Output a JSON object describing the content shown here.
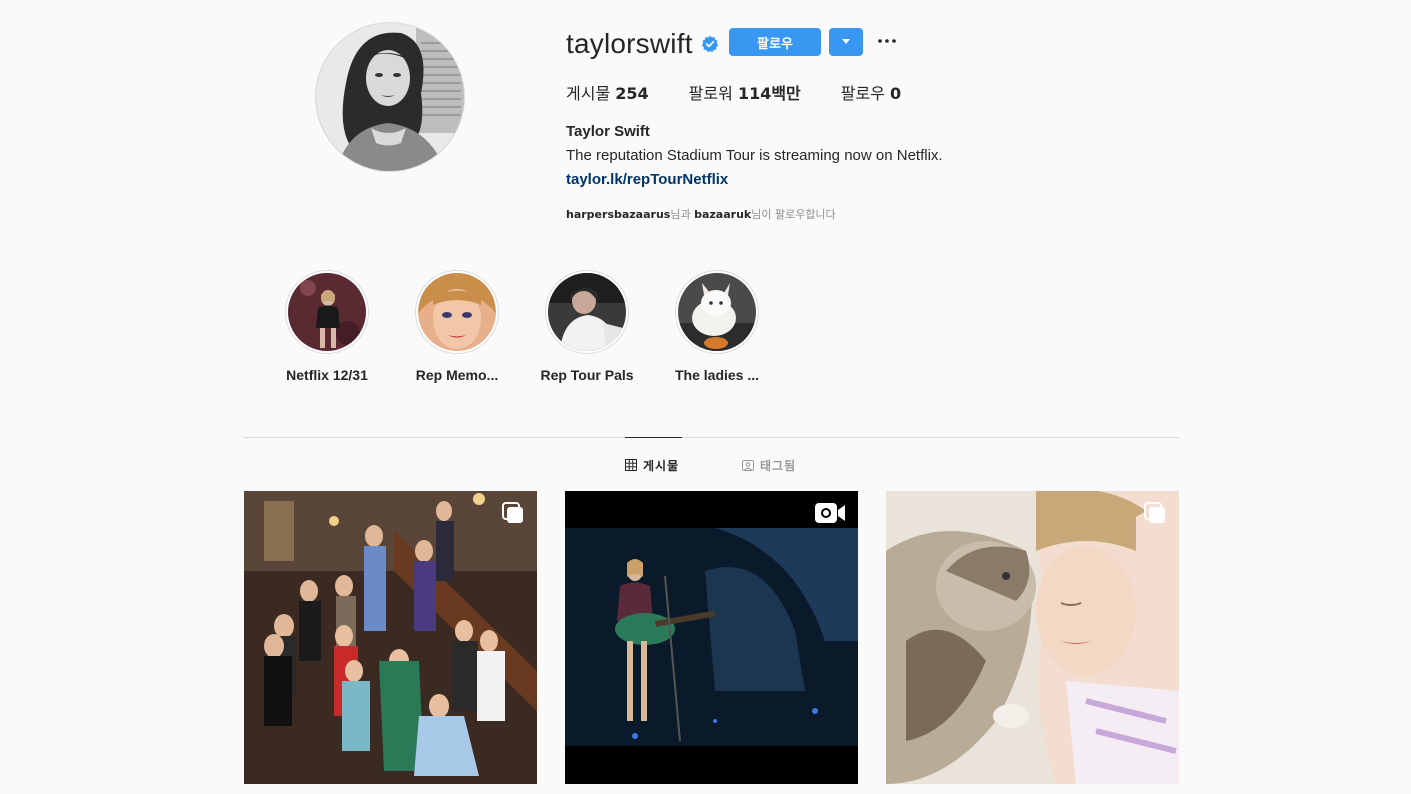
{
  "profile": {
    "username": "taylorswift",
    "follow_label": "팔로우",
    "stats": {
      "posts_label": "게시물",
      "posts_value": "254",
      "followers_label": "팔로워",
      "followers_value": "114백만",
      "following_label": "팔로우",
      "following_value": "0"
    },
    "full_name": "Taylor Swift",
    "bio": "The reputation Stadium Tour is streaming now on Netflix.",
    "link": "taylor.lk/repTourNetflix",
    "followed_by": {
      "user1": "harpersbazaarus",
      "conj": "님과",
      "user2": "bazaaruk",
      "suffix": "님이 팔로우합니다"
    },
    "accent_color": "#3897f0"
  },
  "highlights": [
    {
      "label": "Netflix 12/31"
    },
    {
      "label": "Rep Memo..."
    },
    {
      "label": "Rep Tour Pals"
    },
    {
      "label": "The ladies ..."
    }
  ],
  "tabs": [
    {
      "label": "게시물",
      "icon": "grid-icon",
      "active": true
    },
    {
      "label": "태그됨",
      "icon": "tagged-icon",
      "active": false
    }
  ],
  "posts": [
    {
      "type": "carousel",
      "icon": "multiple-images-icon"
    },
    {
      "type": "video",
      "icon": "video-icon"
    },
    {
      "type": "carousel",
      "icon": "multiple-images-icon"
    }
  ]
}
